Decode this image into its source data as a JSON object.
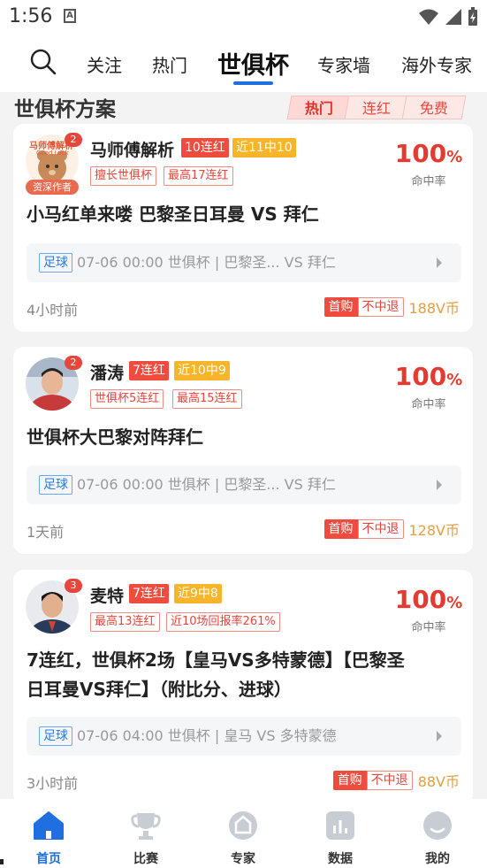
{
  "status_bar": {
    "time": "1:56",
    "sim_label": "A"
  },
  "top_nav": {
    "tabs": [
      {
        "label": "关注"
      },
      {
        "label": "热门"
      },
      {
        "label": "世俱杯",
        "active": true
      },
      {
        "label": "专家墙"
      },
      {
        "label": "海外专家"
      }
    ]
  },
  "section": {
    "title": "世俱杯方案",
    "filters": [
      {
        "label": "热门",
        "active": true
      },
      {
        "label": "连红"
      },
      {
        "label": "免费"
      }
    ]
  },
  "cards": [
    {
      "name": "马师傅解析",
      "badge": "2",
      "avatar_label": "资深作者",
      "avatar_text": "马师傅解析",
      "avatar_sub": "Good Luck",
      "tags_primary": [
        {
          "text": "10连红",
          "style": "red"
        },
        {
          "text": "近11中10",
          "style": "yellow"
        }
      ],
      "tags_secondary": [
        "擅长世俱杯",
        "最高17连红"
      ],
      "rate_value": "100",
      "rate_unit": "%",
      "rate_label": "命中率",
      "headline": "小马红单来喽 巴黎圣日耳曼 VS 拜仁",
      "match": {
        "sport": "足球",
        "info": "07-06 00:00 世俱杯 | 巴黎圣... VS 拜仁"
      },
      "time_ago": "4小时前",
      "price": {
        "first": "首购",
        "no_refund": "不中退",
        "coins": "188V币"
      }
    },
    {
      "name": "潘涛",
      "badge": "2",
      "tags_primary": [
        {
          "text": "7连红",
          "style": "red"
        },
        {
          "text": "近10中9",
          "style": "yellow"
        }
      ],
      "tags_secondary": [
        "世俱杯5连红",
        "最高15连红"
      ],
      "rate_value": "100",
      "rate_unit": "%",
      "rate_label": "命中率",
      "headline": "世俱杯大巴黎对阵拜仁",
      "match": {
        "sport": "足球",
        "info": "07-06 00:00 世俱杯 | 巴黎圣... VS 拜仁"
      },
      "time_ago": "1天前",
      "price": {
        "first": "首购",
        "no_refund": "不中退",
        "coins": "128V币"
      }
    },
    {
      "name": "麦特",
      "badge": "3",
      "tags_primary": [
        {
          "text": "7连红",
          "style": "red"
        },
        {
          "text": "近9中8",
          "style": "yellow"
        }
      ],
      "tags_secondary": [
        "最高13连红",
        "近10场回报率261%"
      ],
      "rate_value": "100",
      "rate_unit": "%",
      "rate_label": "命中率",
      "headline_line1": "7连红，世俱杯2场【皇马VS多特蒙德】【巴黎圣",
      "headline_line2": "日耳曼VS拜仁】（附比分、进球）",
      "match": {
        "sport": "足球",
        "info": "07-06 04:00 世俱杯 | 皇马 VS 多特蒙德"
      },
      "time_ago": "3小时前",
      "price": {
        "first": "首购",
        "no_refund": "不中退",
        "coins": "88V币"
      }
    }
  ],
  "bottom_nav": [
    {
      "label": "首页",
      "icon": "home-icon",
      "active": true
    },
    {
      "label": "比赛",
      "icon": "trophy-icon"
    },
    {
      "label": "专家",
      "icon": "expert-icon"
    },
    {
      "label": "数据",
      "icon": "data-icon"
    },
    {
      "label": "我的",
      "icon": "profile-icon"
    }
  ],
  "colors": {
    "accent_blue": "#1f6fe0",
    "red": "#ef4b3e",
    "yellow": "#f9b52a",
    "coin": "#e0a045"
  }
}
